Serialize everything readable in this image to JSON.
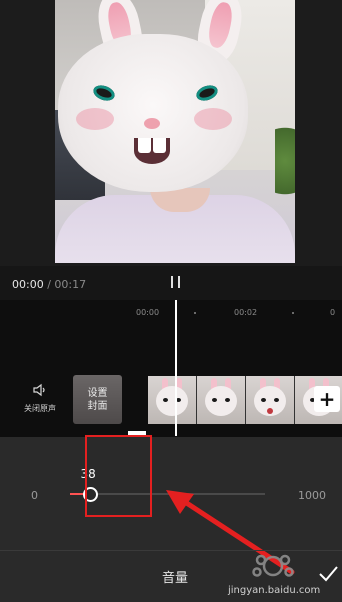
{
  "player": {
    "current_time": "00:00",
    "separator": "/",
    "total_time": "00:17"
  },
  "timeline": {
    "ruler_labels": [
      "00:00",
      "00:02"
    ],
    "mute_label": "关闭原声",
    "cover_label_line1": "设置",
    "cover_label_line2": "封面",
    "add_clip_label": "+"
  },
  "volume": {
    "min_label": "0",
    "max_label": "1000",
    "value": "38",
    "value_fraction": 0.1,
    "title": "音量"
  },
  "watermark": {
    "text": "jingyan.baidu.com"
  },
  "colors": {
    "background": "#161616",
    "panel": "#2a2a2a",
    "accent": "#ff5252",
    "annotation": "#e42020"
  }
}
